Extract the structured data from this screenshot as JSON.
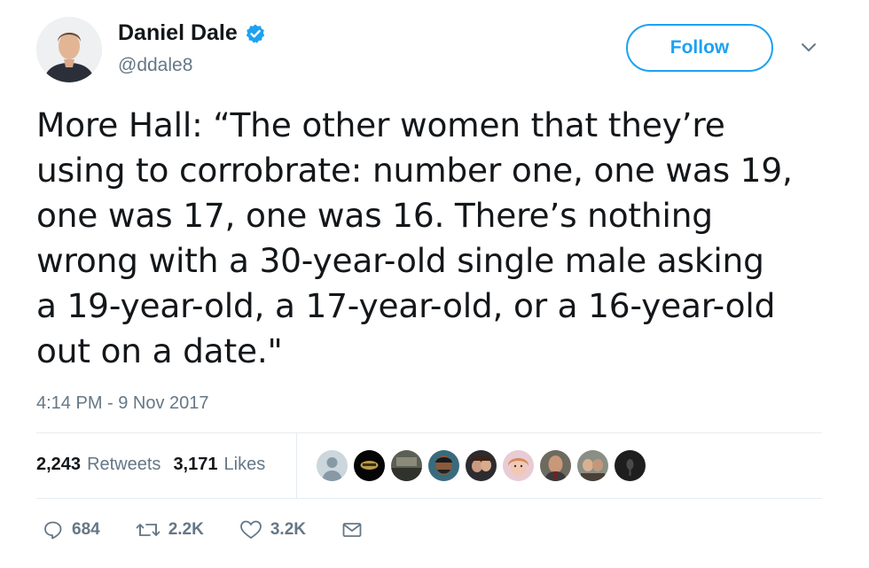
{
  "author": {
    "display_name": "Daniel Dale",
    "handle": "@ddale8",
    "verified": true
  },
  "follow_button": {
    "label": "Follow"
  },
  "tweet": {
    "text": "More Hall: “The other women that they’re\nusing to corrobrate: number one, one was 19,\none was 17, one was 16. There’s nothing\nwrong with a 30-year-old single male asking\na 19-year-old, a 17-year-old, or a 16-year-old\nout on a date.\"",
    "timestamp": "4:14 PM - 9 Nov 2017"
  },
  "stats": {
    "retweets_count": "2,243",
    "retweets_label": "Retweets",
    "likes_count": "3,171",
    "likes_label": "Likes"
  },
  "liked_by": [
    {
      "icon": "default-avatar"
    },
    {
      "icon": "avatar"
    },
    {
      "icon": "avatar"
    },
    {
      "icon": "avatar"
    },
    {
      "icon": "avatar"
    },
    {
      "icon": "avatar"
    },
    {
      "icon": "avatar"
    },
    {
      "icon": "avatar"
    },
    {
      "icon": "avatar"
    }
  ],
  "actions": {
    "replies": "684",
    "retweets": "2.2K",
    "likes": "3.2K"
  },
  "colors": {
    "accent": "#1da1f2",
    "muted": "#657786",
    "text": "#14171a",
    "divider": "#e6ecf0"
  }
}
